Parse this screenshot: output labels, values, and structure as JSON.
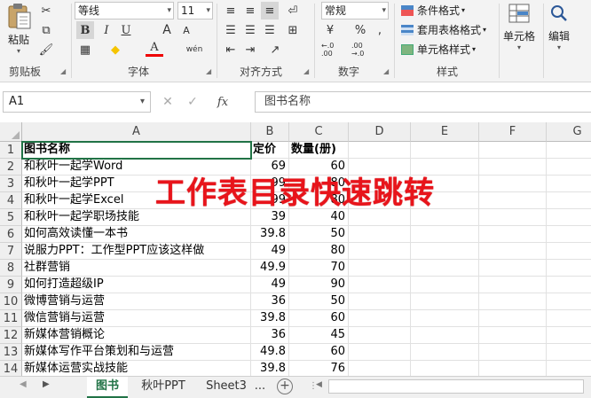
{
  "ribbon": {
    "clipboard": {
      "paste_label": "粘贴",
      "group_label": "剪贴板"
    },
    "font": {
      "font_name": "等线",
      "font_size": "11",
      "group_label": "字体",
      "bold": "B",
      "italic": "I",
      "underline": "U",
      "increase_size": "A",
      "decrease_size": "A",
      "font_color": "A",
      "phonetic": "wén"
    },
    "alignment": {
      "group_label": "对齐方式"
    },
    "number": {
      "format": "常规",
      "group_label": "数字",
      "percent": "%",
      "comma": ",",
      "increase_decimal": "←.0 .00",
      "decrease_decimal": ".00 →.0"
    },
    "styles": {
      "conditional_format": "条件格式",
      "table_format": "套用表格格式",
      "cell_styles": "单元格样式",
      "group_label": "样式"
    },
    "cells": {
      "label": "单元格"
    },
    "editing": {
      "label": "编辑"
    }
  },
  "formula_bar": {
    "name_box": "A1",
    "fx": "fx",
    "content": "图书名称"
  },
  "columns": [
    "A",
    "B",
    "C",
    "D",
    "E",
    "F",
    "G"
  ],
  "rows": [
    {
      "num": "1",
      "a": "图书名称",
      "b": "定价",
      "c": "数量(册)"
    },
    {
      "num": "2",
      "a": "和秋叶一起学Word",
      "b": "69",
      "c": "60"
    },
    {
      "num": "3",
      "a": "和秋叶一起学PPT",
      "b": "99",
      "c": "80"
    },
    {
      "num": "4",
      "a": "和秋叶一起学Excel",
      "b": "99",
      "c": "80"
    },
    {
      "num": "5",
      "a": "和秋叶一起学职场技能",
      "b": "39",
      "c": "40"
    },
    {
      "num": "6",
      "a": "如何高效读懂一本书",
      "b": "39.8",
      "c": "50"
    },
    {
      "num": "7",
      "a": "说服力PPT：工作型PPT应该这样做",
      "b": "49",
      "c": "80"
    },
    {
      "num": "8",
      "a": "社群营销",
      "b": "49.9",
      "c": "70"
    },
    {
      "num": "9",
      "a": "如何打造超级IP",
      "b": "49",
      "c": "90"
    },
    {
      "num": "10",
      "a": "微博营销与运营",
      "b": "36",
      "c": "50"
    },
    {
      "num": "11",
      "a": "微信营销与运营",
      "b": "39.8",
      "c": "60"
    },
    {
      "num": "12",
      "a": "新媒体营销概论",
      "b": "36",
      "c": "45"
    },
    {
      "num": "13",
      "a": "新媒体写作平台策划和与运营",
      "b": "49.8",
      "c": "60"
    },
    {
      "num": "14",
      "a": "新媒体运营实战技能",
      "b": "39.8",
      "c": "76"
    }
  ],
  "overlay_title": "工作表目录快速跳转",
  "sheet_tabs": [
    "图书",
    "秋叶PPT",
    "Sheet3"
  ],
  "tabs_more": "...",
  "colors": {
    "accent": "#217346",
    "overlay": "#e8141b"
  }
}
